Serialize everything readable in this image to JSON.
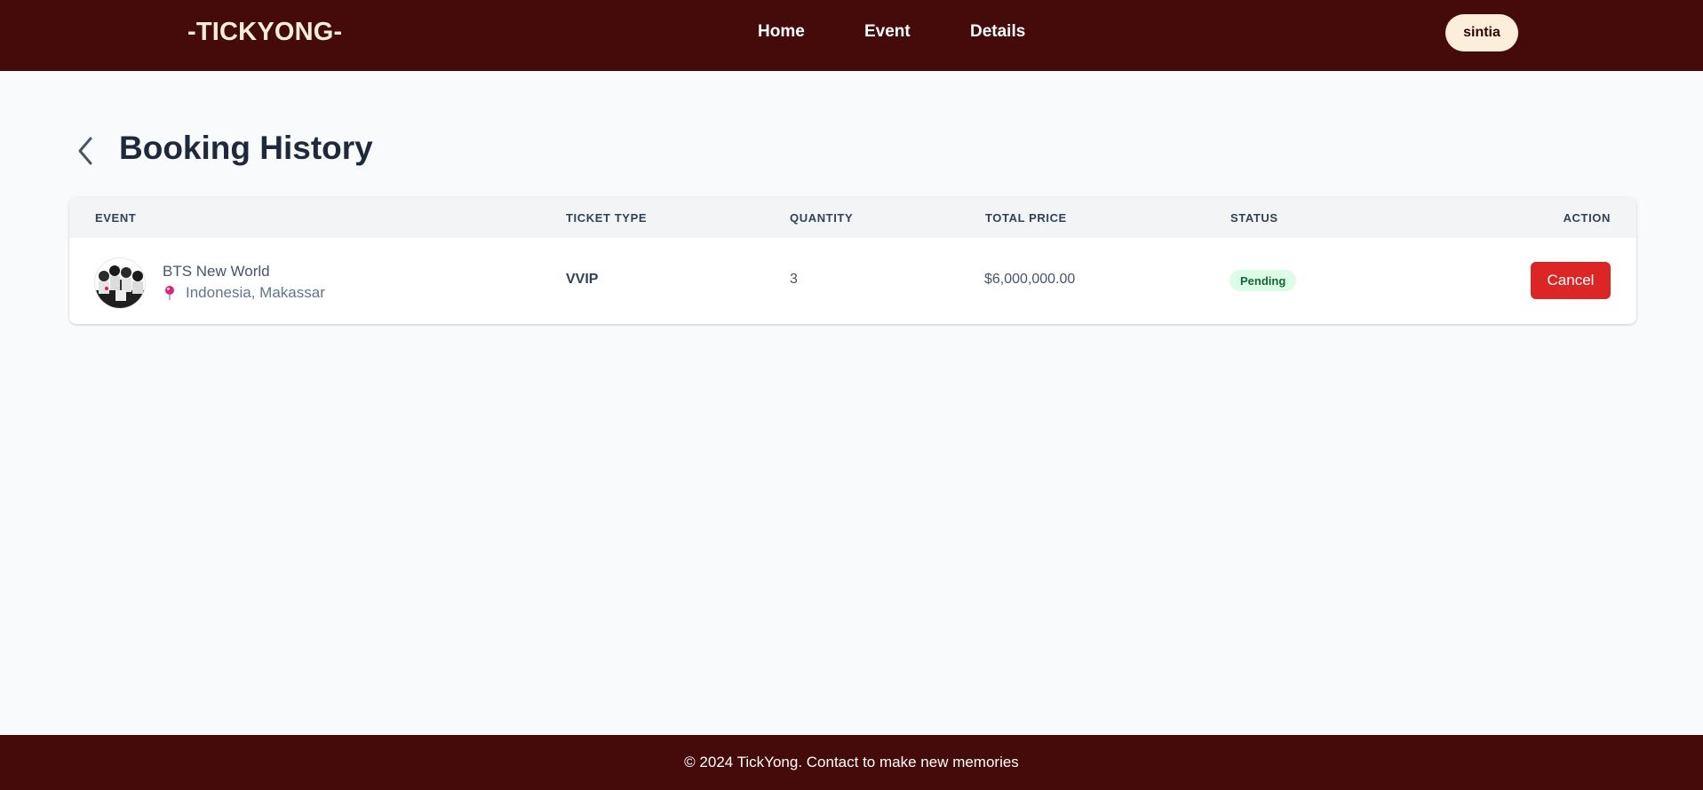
{
  "header": {
    "logo": "-TICKYONG-",
    "nav": [
      "Home",
      "Event",
      "Details"
    ],
    "user": "sintia"
  },
  "page": {
    "title": "Booking History"
  },
  "table": {
    "columns": [
      "EVENT",
      "TICKET TYPE",
      "QUANTITY",
      "TOTAL PRICE",
      "STATUS",
      "ACTION"
    ],
    "rows": [
      {
        "event_name": "BTS New World",
        "location": "Indonesia, Makassar",
        "ticket_type": "VVIP",
        "quantity": "3",
        "total_price": "$6,000,000.00",
        "status": "Pending",
        "action": "Cancel"
      }
    ]
  },
  "footer": {
    "text": "© 2024 TickYong. Contact to make new memories"
  },
  "colors": {
    "navbar_bg": "#450a0a",
    "logo": "#fdeedb",
    "cancel_button": "#dc2626",
    "status_pending_bg": "#dcfce7",
    "status_pending_text": "#166534"
  }
}
